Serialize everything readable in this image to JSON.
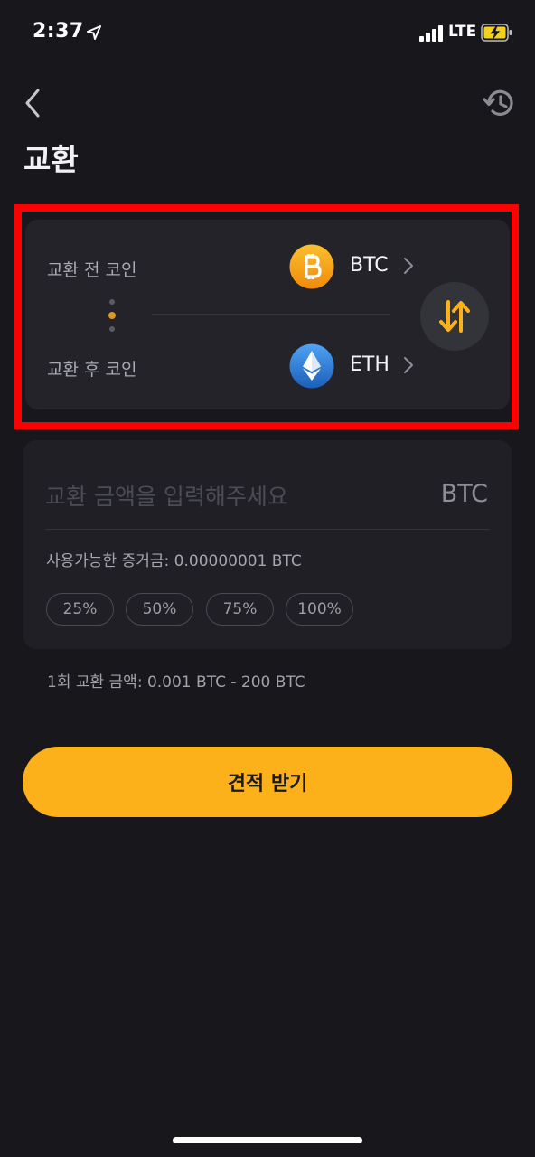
{
  "status_bar": {
    "time": "2:37",
    "network": "LTE"
  },
  "header": {
    "title": "교환"
  },
  "swap": {
    "from_label": "교환 전 코인",
    "from_coin": "BTC",
    "to_label": "교환 후 코인",
    "to_coin": "ETH"
  },
  "amount": {
    "placeholder": "교환 금액을 입력해주세요",
    "unit": "BTC",
    "available": "사용가능한 증거금:  0.00000001 BTC",
    "percent_options": [
      "25%",
      "50%",
      "75%",
      "100%"
    ]
  },
  "limit_text": "1회 교환 금액: 0.001 BTC  -  200 BTC",
  "quote_button": "견적 받기",
  "icons": {
    "status": [
      "location-arrow-icon",
      "signal-bars-icon",
      "battery-charging-icon"
    ],
    "nav": [
      "back-chevron-icon",
      "history-clock-icon"
    ],
    "coins": [
      "bitcoin-icon",
      "ethereum-icon"
    ],
    "swap": "swap-arrows-icon"
  },
  "colors": {
    "background": "#17171c",
    "card": "#232329",
    "accent": "#fcb019",
    "highlight": "#ff0000",
    "bitcoin": "#f7a21b",
    "ethereum": "#2f7fd8"
  }
}
